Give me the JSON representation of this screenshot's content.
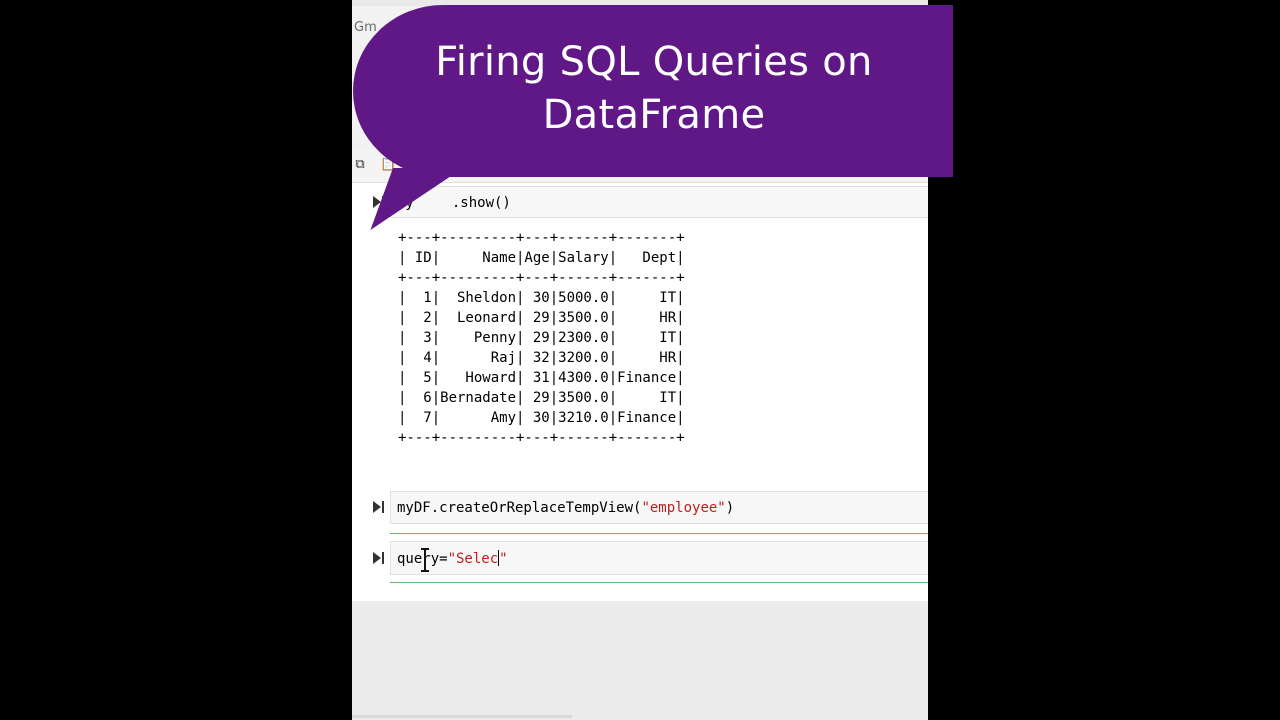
{
  "browser": {
    "tab_text": "Gm"
  },
  "cells": [
    {
      "code": "myDF.show()",
      "code_visible_prefix": "my",
      "code_visible_suffix": ".show()"
    },
    {
      "code_before_string": "myDF.createOrReplaceTempView(",
      "string": "\"employee\"",
      "code_after_string": ")"
    },
    {
      "code_before_string": "query=",
      "string": "\"Selec",
      "string_close": "\""
    }
  ],
  "table_output": {
    "border": "+---+---------+---+------+-------+",
    "header": "| ID|     Name|Age|Salary|   Dept|",
    "columns": [
      "ID",
      "Name",
      "Age",
      "Salary",
      "Dept"
    ],
    "rows": [
      [
        "1",
        "Sheldon",
        "30",
        "5000.0",
        "IT"
      ],
      [
        "2",
        "Leonard",
        "29",
        "3500.0",
        "HR"
      ],
      [
        "3",
        "Penny",
        "29",
        "2300.0",
        "IT"
      ],
      [
        "4",
        "Raj",
        "32",
        "3200.0",
        "HR"
      ],
      [
        "5",
        "Howard",
        "31",
        "4300.0",
        "Finance"
      ],
      [
        "6",
        "Bernadate",
        "29",
        "3500.0",
        "IT"
      ],
      [
        "7",
        "Amy",
        "30",
        "3210.0",
        "Finance"
      ]
    ],
    "text": "+---+---------+---+------+-------+\n| ID|     Name|Age|Salary|   Dept|\n+---+---------+---+------+-------+\n|  1|  Sheldon| 30|5000.0|     IT|\n|  2|  Leonard| 29|3500.0|     HR|\n|  3|    Penny| 29|2300.0|     IT|\n|  4|      Raj| 32|3200.0|     HR|\n|  5|   Howard| 31|4300.0|Finance|\n|  6|Bernadate| 29|3500.0|     IT|\n|  7|      Amy| 30|3210.0|Finance|\n+---+---------+---+------+-------+"
  },
  "overlay": {
    "title_line1": "Firing SQL Queries on",
    "title_line2": "DataFrame",
    "bubble_color": "#5f1886"
  },
  "icons": {
    "run": "run-cell-icon",
    "copy": "copy-icon",
    "paste": "paste-icon"
  }
}
